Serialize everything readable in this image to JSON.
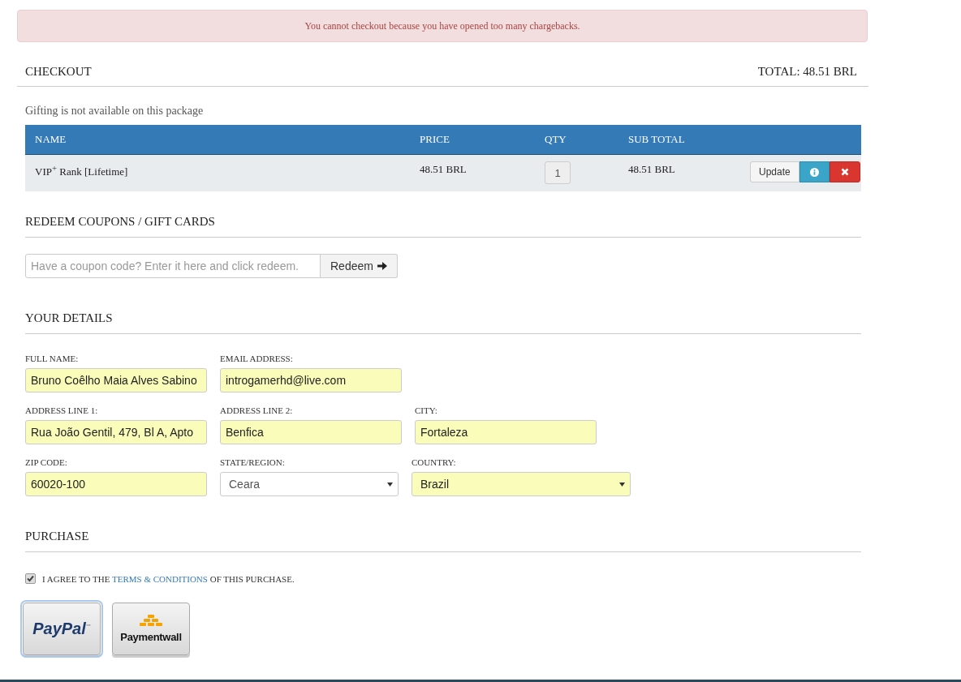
{
  "alert": {
    "message": "You cannot checkout because you have opened too many chargebacks."
  },
  "checkout": {
    "title": "CHECKOUT",
    "total": "TOTAL: 48.51 BRL"
  },
  "gifting_note": "Gifting is not available on this package",
  "cart": {
    "columns": [
      "NAME",
      "PRICE",
      "QTY",
      "SUB TOTAL"
    ],
    "rows": [
      {
        "name": "VIP$^{+}$ Rank [Lifetime]",
        "price": "48.51 BRL",
        "qty": "1",
        "subtotal": "48.51 BRL",
        "update": "Update"
      }
    ]
  },
  "coupons": {
    "title": "REDEEM COUPONS / GIFT CARDS",
    "placeholder": "Have a coupon code? Enter it here and click redeem.",
    "button": "Redeem"
  },
  "details": {
    "title": "YOUR DETAILS",
    "rows": [
      [
        {
          "label": "FULL NAME:",
          "value": "Bruno Coêlho Maia Alves Sabino",
          "kind": "input",
          "autofilled": true
        },
        {
          "label": "EMAIL ADDRESS:",
          "value": "introgamerhd@live.com",
          "kind": "input",
          "autofilled": true
        }
      ],
      [
        {
          "label": "ADDRESS LINE 1:",
          "value": "Rua João Gentil, 479, Bl A, Apto",
          "kind": "input",
          "autofilled": true
        },
        {
          "label": "ADDRESS LINE 2:",
          "value": "Benfica",
          "kind": "input",
          "autofilled": true
        },
        {
          "label": "CITY:",
          "value": "Fortaleza",
          "kind": "input",
          "autofilled": true
        }
      ],
      [
        {
          "label": "ZIP CODE:",
          "value": "60020-100",
          "kind": "input",
          "autofilled": true
        },
        {
          "label": "STATE/REGION:",
          "value": "Ceara",
          "kind": "select",
          "autofilled": false
        },
        {
          "label": "COUNTRY:",
          "value": "Brazil",
          "kind": "select",
          "autofilled": true
        }
      ]
    ]
  },
  "purchase": {
    "title": "PURCHASE",
    "agree": {
      "checked": true,
      "before": "I AGREE TO THE",
      "link": "TERMS & CONDITIONS",
      "after": "OF THIS PURCHASE."
    },
    "methods": [
      {
        "kind": "paypal",
        "name": "PayPal",
        "mark": "™",
        "selected": true
      },
      {
        "kind": "paymentwall",
        "name": "Paymentwall",
        "selected": false
      }
    ]
  }
}
